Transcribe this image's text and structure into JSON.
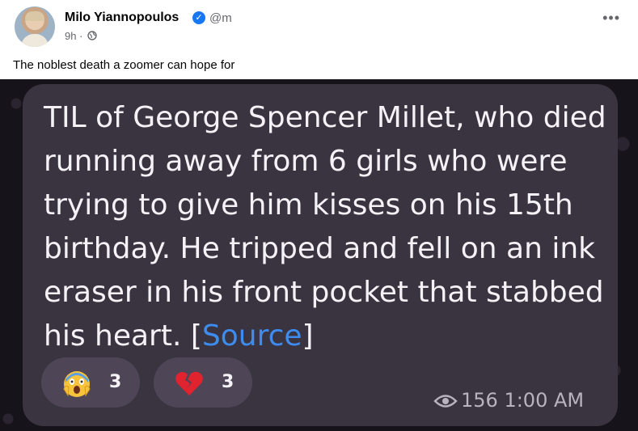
{
  "post": {
    "author": "Milo Yiannopoulos",
    "handle": "@m",
    "time": "9h",
    "separator": " · ",
    "caption": "The noblest death a zoomer can hope for",
    "more_label": "•••"
  },
  "message": {
    "text": "TIL of George Spencer Millet, who died running away from 6 girls who were trying to give him kisses on his 15th birthday. He tripped and fell on an ink eraser in his front pocket that stabbed his heart. [",
    "link_text": "Source",
    "text_end": "]",
    "reactions": [
      {
        "emoji": "scream-emoji-icon",
        "count": "3"
      },
      {
        "emoji": "broken-heart-icon",
        "count": "3"
      }
    ],
    "views": "156",
    "time": "1:00 AM"
  },
  "colors": {
    "accent": "#1877f2",
    "bubble": "#3a3340",
    "link": "#3e8cf0"
  }
}
